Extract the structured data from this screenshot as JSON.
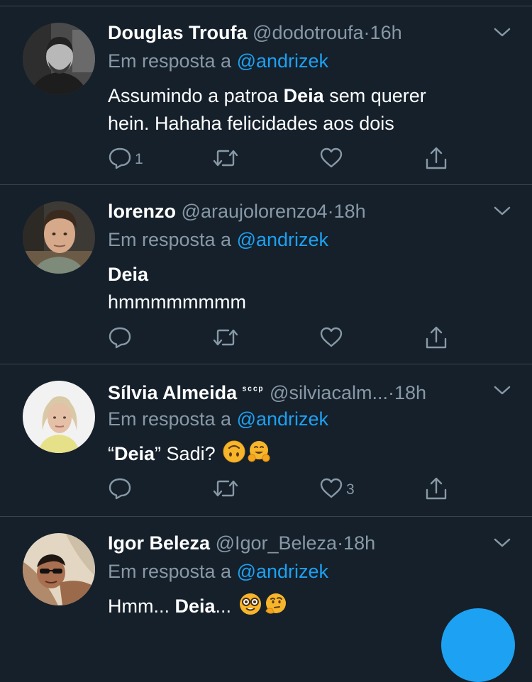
{
  "tweets": [
    {
      "name": "Douglas Troufa",
      "badge": "",
      "handle": "@dodotroufa",
      "sep": "·",
      "time": "16h",
      "reply_prefix": "Em resposta a",
      "reply_to": "@andrizek",
      "line1_a": "Assumindo a patroa ",
      "line1_b": "Deia",
      "line1_c": " sem querer",
      "line2": "hein. Hahaha felicidades aos dois",
      "reply_count": "1",
      "retweet_count": "",
      "like_count": ""
    },
    {
      "name": "lorenzo",
      "badge": "",
      "handle": "@araujolorenzo4",
      "sep": "·",
      "time": "18h",
      "reply_prefix": "Em resposta a",
      "reply_to": "@andrizek",
      "line1_b": "Deia",
      "line2": "hmmmmmmmm",
      "reply_count": "",
      "retweet_count": "",
      "like_count": ""
    },
    {
      "name": "Sílvia Almeida",
      "badge": "ˢᶜᶜᵖ",
      "handle": "@silviacalm...",
      "sep": "·",
      "time": "18h",
      "reply_prefix": "Em resposta a",
      "reply_to": "@andrizek",
      "line1_a": "“",
      "line1_b": "Deia",
      "line1_c": "” Sadi?",
      "emojis": [
        "upside-down-face-emoji",
        "hugging-face-emoji"
      ],
      "reply_count": "",
      "retweet_count": "",
      "like_count": "3"
    },
    {
      "name": "Igor Beleza",
      "badge": "",
      "handle": "@Igor_Beleza",
      "sep": "·",
      "time": "18h",
      "reply_prefix": "Em resposta a",
      "reply_to": "@andrizek",
      "line1_a": "Hmm... ",
      "line1_b": "Deia",
      "line1_c": "...",
      "emojis": [
        "nerd-face-emoji",
        "thinking-face-emoji"
      ]
    }
  ],
  "icons": {
    "reply": "reply-icon",
    "retweet": "retweet-icon",
    "like": "heart-icon",
    "share": "share-icon",
    "menu": "chevron-down-icon",
    "compose": "compose-fab"
  },
  "colors": {
    "background": "#15202b",
    "divider": "#38444d",
    "secondary_text": "#8899a6",
    "accent": "#1da1f2"
  }
}
